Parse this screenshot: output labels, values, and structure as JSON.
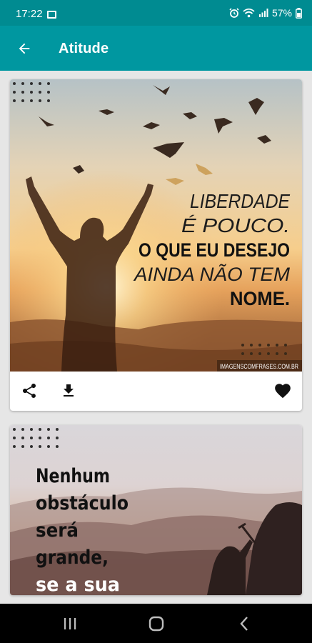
{
  "status_bar": {
    "time": "17:22",
    "battery": "57%",
    "icons": [
      "image-icon",
      "alarm-icon",
      "wifi-icon",
      "signal-icon",
      "battery-icon"
    ]
  },
  "app_bar": {
    "title": "Atitude",
    "back_icon": "arrow-left-icon",
    "color": "#0097a0",
    "status_color": "#008b91"
  },
  "cards": [
    {
      "quote_lines": [
        "LIBERDADE",
        "É POUCO.",
        "O QUE EU DESEJO",
        "AINDA NÃO TEM",
        "NOME."
      ],
      "watermark": "IMAGENSCOMFRASES.COM.BR",
      "actions": {
        "share_icon": "share-icon",
        "download_icon": "download-icon",
        "favorite_icon": "heart-icon"
      }
    },
    {
      "quote_lines": [
        "Nenhum",
        "obstáculo",
        "será",
        "grande,",
        "se a sua"
      ]
    }
  ],
  "nav_bar": {
    "icons": [
      "recents-icon",
      "home-icon",
      "back-icon"
    ]
  }
}
